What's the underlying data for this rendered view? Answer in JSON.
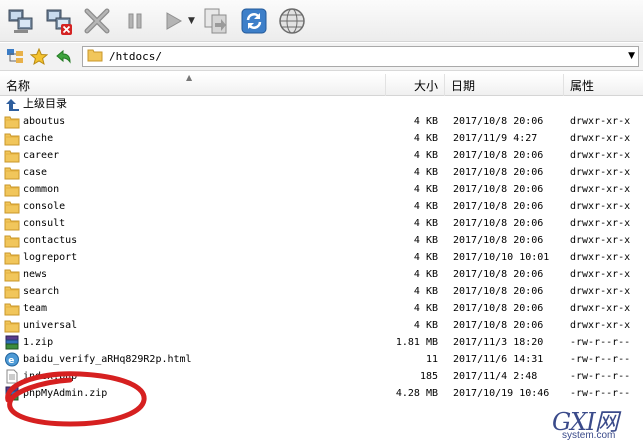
{
  "toolbar": {
    "buttons": [
      "connect-icon",
      "disconnect-icon",
      "cancel-icon",
      "pause-icon",
      "play-icon",
      "transfer-icon",
      "refresh-icon",
      "globe-icon"
    ]
  },
  "address": {
    "path": "/htdocs/"
  },
  "columns": {
    "name": "名称",
    "size": "大小",
    "date": "日期",
    "attr": "属性"
  },
  "parent_dir": "上级目录",
  "rows": [
    {
      "name": "aboutus",
      "size": "4 KB",
      "date": "2017/10/8 20:06",
      "attr": "drwxr-xr-x",
      "icon": "folder"
    },
    {
      "name": "cache",
      "size": "4 KB",
      "date": "2017/11/9 4:27",
      "attr": "drwxr-xr-x",
      "icon": "folder"
    },
    {
      "name": "career",
      "size": "4 KB",
      "date": "2017/10/8 20:06",
      "attr": "drwxr-xr-x",
      "icon": "folder"
    },
    {
      "name": "case",
      "size": "4 KB",
      "date": "2017/10/8 20:06",
      "attr": "drwxr-xr-x",
      "icon": "folder"
    },
    {
      "name": "common",
      "size": "4 KB",
      "date": "2017/10/8 20:06",
      "attr": "drwxr-xr-x",
      "icon": "folder"
    },
    {
      "name": "console",
      "size": "4 KB",
      "date": "2017/10/8 20:06",
      "attr": "drwxr-xr-x",
      "icon": "folder"
    },
    {
      "name": "consult",
      "size": "4 KB",
      "date": "2017/10/8 20:06",
      "attr": "drwxr-xr-x",
      "icon": "folder"
    },
    {
      "name": "contactus",
      "size": "4 KB",
      "date": "2017/10/8 20:06",
      "attr": "drwxr-xr-x",
      "icon": "folder"
    },
    {
      "name": "logreport",
      "size": "4 KB",
      "date": "2017/10/10 10:01",
      "attr": "drwxr-xr-x",
      "icon": "folder"
    },
    {
      "name": "news",
      "size": "4 KB",
      "date": "2017/10/8 20:06",
      "attr": "drwxr-xr-x",
      "icon": "folder"
    },
    {
      "name": "search",
      "size": "4 KB",
      "date": "2017/10/8 20:06",
      "attr": "drwxr-xr-x",
      "icon": "folder"
    },
    {
      "name": "team",
      "size": "4 KB",
      "date": "2017/10/8 20:06",
      "attr": "drwxr-xr-x",
      "icon": "folder"
    },
    {
      "name": "universal",
      "size": "4 KB",
      "date": "2017/10/8 20:06",
      "attr": "drwxr-xr-x",
      "icon": "folder"
    },
    {
      "name": "1.zip",
      "size": "1.81 MB",
      "date": "2017/11/3 18:20",
      "attr": "-rw-r--r--",
      "icon": "archive"
    },
    {
      "name": "baidu_verify_aRHq829R2p.html",
      "size": "11",
      "date": "2017/11/6 14:31",
      "attr": "-rw-r--r--",
      "icon": "html"
    },
    {
      "name": "index.php",
      "size": "185",
      "date": "2017/11/4 2:48",
      "attr": "-rw-r--r--",
      "icon": "php"
    },
    {
      "name": "phpMyAdmin.zip",
      "size": "4.28 MB",
      "date": "2017/10/19 10:46",
      "attr": "-rw-r--r--",
      "icon": "archive"
    }
  ],
  "watermark": {
    "main": "GXI网",
    "sub": "system.com"
  }
}
